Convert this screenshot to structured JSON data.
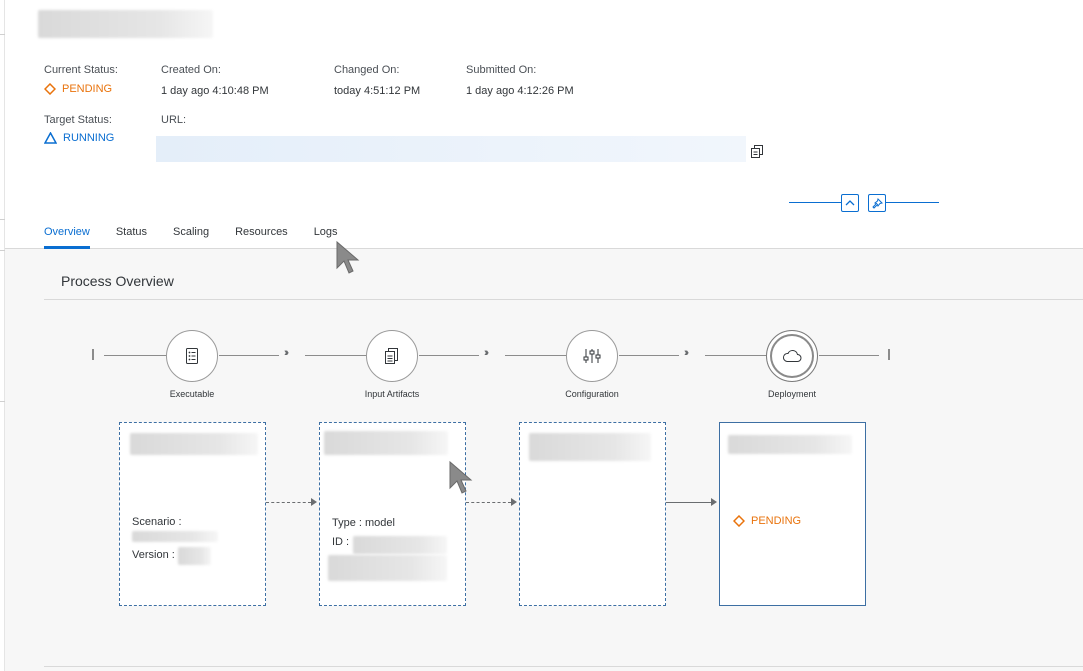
{
  "header": {
    "current_status_label": "Current Status:",
    "current_status_value": "PENDING",
    "target_status_label": "Target Status:",
    "target_status_value": "RUNNING",
    "created_on_label": "Created On:",
    "created_on_value": "1 day ago 4:10:48 PM",
    "changed_on_label": "Changed On:",
    "changed_on_value": "today 4:51:12 PM",
    "submitted_on_label": "Submitted On:",
    "submitted_on_value": "1 day ago 4:12:26 PM",
    "url_label": "URL:"
  },
  "tabs": [
    {
      "label": "Overview",
      "active": true
    },
    {
      "label": "Status",
      "active": false
    },
    {
      "label": "Scaling",
      "active": false
    },
    {
      "label": "Resources",
      "active": false
    },
    {
      "label": "Logs",
      "active": false
    }
  ],
  "process": {
    "title": "Process Overview",
    "steps": [
      {
        "label": "Executable",
        "icon": "list-icon"
      },
      {
        "label": "Input Artifacts",
        "icon": "documents-icon"
      },
      {
        "label": "Configuration",
        "icon": "sliders-icon"
      },
      {
        "label": "Deployment",
        "icon": "cloud-icon"
      }
    ],
    "cards": {
      "executable": {
        "scenario_label": "Scenario :",
        "version_label": "Version :"
      },
      "artifacts": {
        "type_text": "Type : model",
        "id_label": "ID :"
      },
      "deployment": {
        "status": "PENDING"
      }
    }
  },
  "colors": {
    "accent": "#0a6ed1",
    "pending": "#e9730c",
    "card_border": "#3d6fa3"
  }
}
